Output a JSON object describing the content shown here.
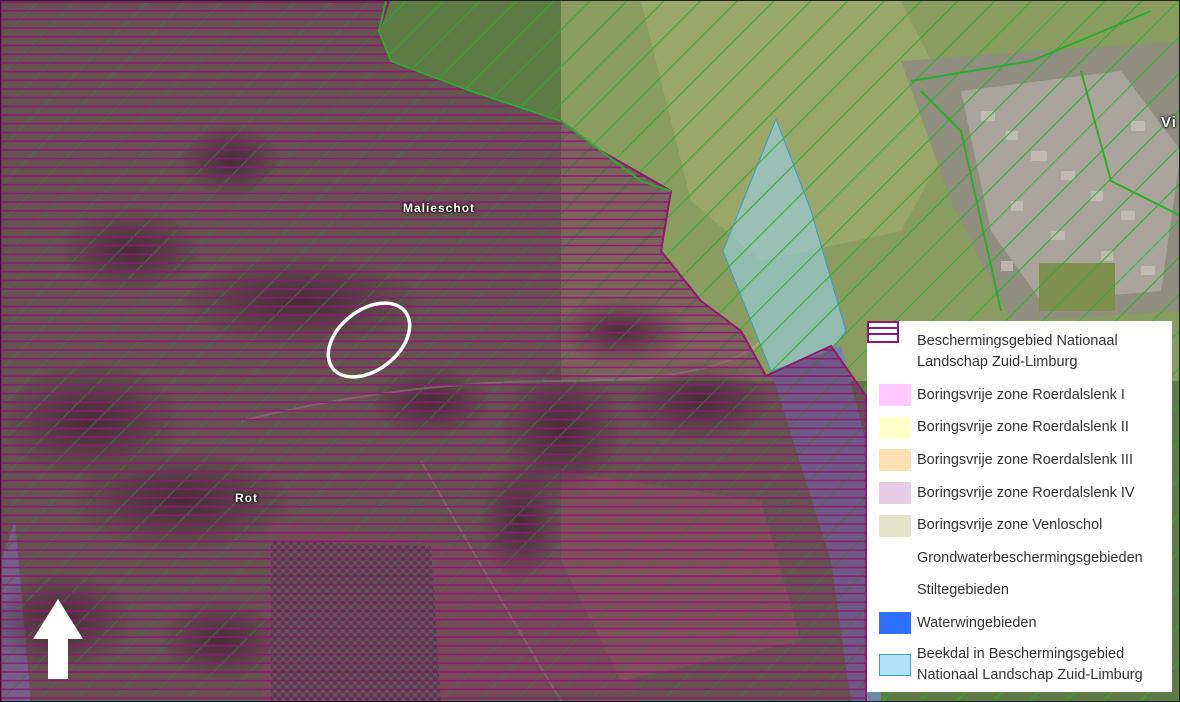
{
  "map": {
    "place_labels": [
      "Malieschot",
      "Rot",
      "Vi"
    ]
  },
  "colors": {
    "protection_green": "#2eab2e",
    "silence_purple": "#8e1a6e",
    "beekdal_blue": "#9bd6f2",
    "waterwin_blue": "#2d6fff",
    "groundwater_navy": "#1a3e8f"
  },
  "legend": {
    "items": [
      {
        "label": "Beschermingsgebied Nationaal Landschap Zuid-Limburg",
        "swatch": "green-hatch"
      },
      {
        "label": "Boringsvrije zone Roerdalslenk I",
        "swatch": "#ffc8ff"
      },
      {
        "label": "Boringsvrije zone Roerdalslenk II",
        "swatch": "#ffffc8"
      },
      {
        "label": "Boringsvrije zone Roerdalslenk III",
        "swatch": "#fde0b2"
      },
      {
        "label": "Boringsvrije zone Roerdalslenk IV",
        "swatch": "#e6cce6"
      },
      {
        "label": "Boringsvrije zone Venloschol",
        "swatch": "#e4e4cc"
      },
      {
        "label": "Grondwaterbeschermingsgebieden",
        "swatch": "navy-cross"
      },
      {
        "label": "Stiltegebieden",
        "swatch": "purple-lines"
      },
      {
        "label": "Waterwingebieden",
        "swatch": "#2d6fff"
      },
      {
        "label": "Beekdal in Beschermingsgebied Nationaal Landschap Zuid-Limburg",
        "swatch": "#b3e3f8"
      }
    ]
  }
}
